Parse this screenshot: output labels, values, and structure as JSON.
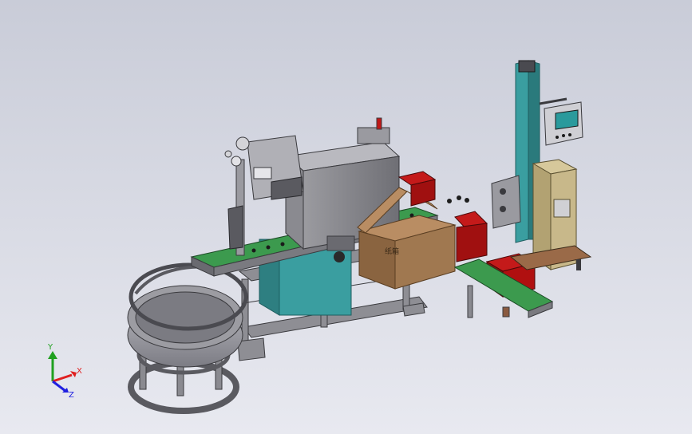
{
  "viewport": {
    "background_top": "#c9ccd8",
    "background_bottom": "#e8e9f0"
  },
  "model": {
    "box_label": "纸箱"
  },
  "triad": {
    "x_label": "X",
    "y_label": "Y",
    "z_label": "Z",
    "x_color": "#e02020",
    "y_color": "#20a020",
    "z_color": "#2020e0"
  },
  "colors": {
    "frame_gray": "#8e8e94",
    "conveyor_green": "#3c9a4e",
    "cabinet_teal": "#3a9ea0",
    "red_box": "#b01010",
    "cardboard": "#a07850",
    "tan_panel": "#c8b88a"
  }
}
